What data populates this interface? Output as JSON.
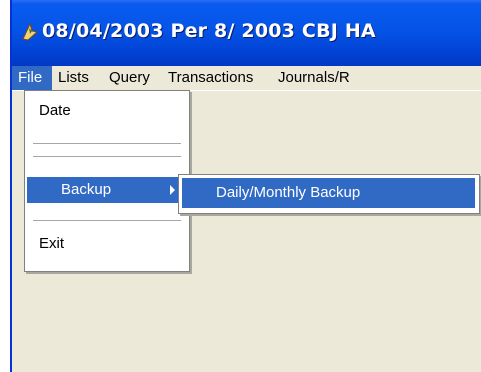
{
  "window": {
    "title": "08/04/2003   Per  8/ 2003 CBJ HA"
  },
  "menubar": {
    "items": [
      "File",
      "Lists",
      "Query",
      "Transactions",
      "Journals/R"
    ]
  },
  "file_menu": {
    "date_label": "Date",
    "backup_label": "Backup",
    "exit_label": "Exit"
  },
  "backup_submenu": {
    "items": [
      "Daily/Monthly Backup"
    ]
  },
  "colors": {
    "highlight": "#316ac5",
    "titlebar": "#0554e7",
    "window_bg": "#ece9d8"
  }
}
